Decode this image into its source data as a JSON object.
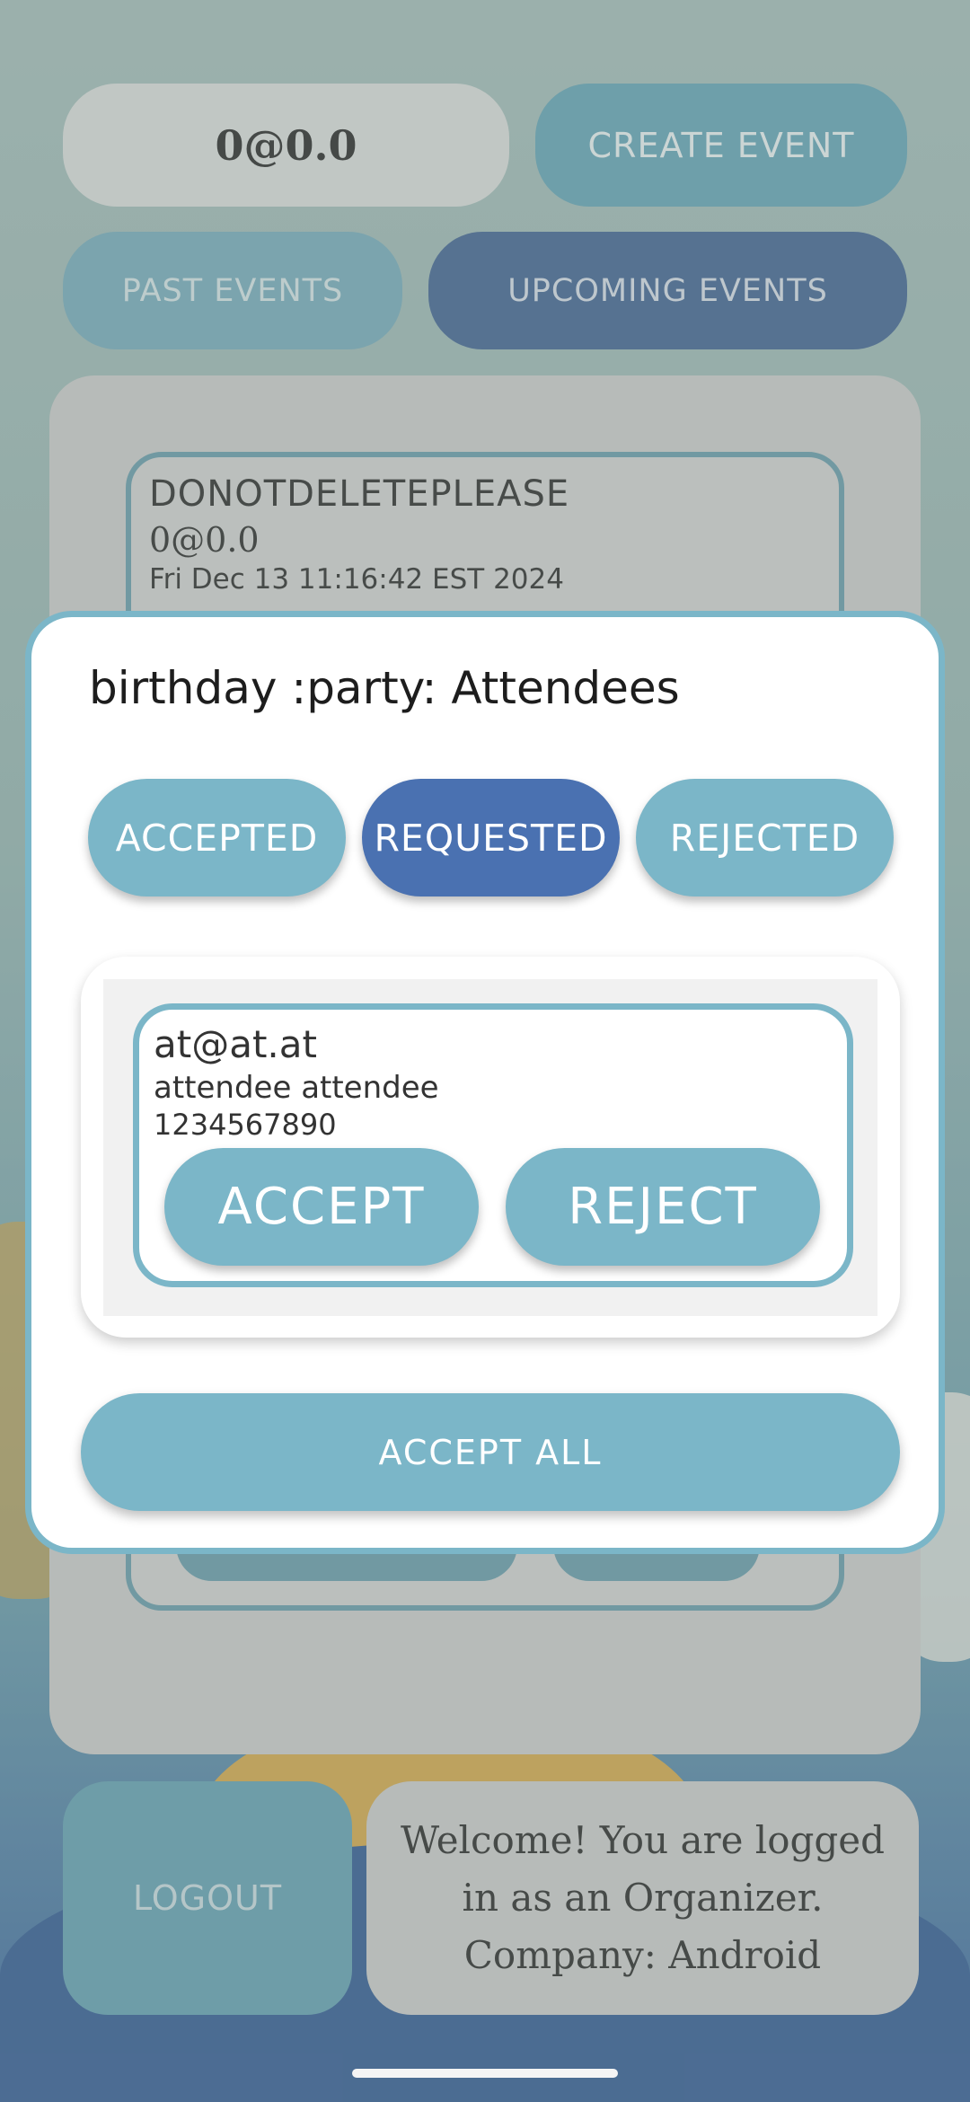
{
  "header": {
    "user_chip": "0@0.0",
    "create_event_label": "CREATE EVENT",
    "past_events_label": "PAST EVENTS",
    "upcoming_events_label": "UPCOMING EVENTS"
  },
  "event_card": {
    "title": "DONOTDELETEPLEASE",
    "organizer": "0@0.0",
    "date": "Fri Dec 13 11:16:42 EST 2024"
  },
  "footer": {
    "logout_label": "LOGOUT",
    "welcome_text": "Welcome! You are logged in as an Organizer. Company: Android"
  },
  "dialog": {
    "title": "birthday :party: Attendees",
    "tabs": [
      {
        "label": "ACCEPTED",
        "active": false
      },
      {
        "label": "REQUESTED",
        "active": true
      },
      {
        "label": "REJECTED",
        "active": false
      }
    ],
    "attendees": [
      {
        "email": "at@at.at",
        "name": "attendee attendee",
        "phone": "1234567890",
        "accept_label": "ACCEPT",
        "reject_label": "REJECT"
      }
    ],
    "accept_all_label": "ACCEPT ALL"
  },
  "colors": {
    "accent": "#7bb6c8",
    "active_tab": "#4a71b1",
    "dialog_border": "#7bb6c8"
  }
}
